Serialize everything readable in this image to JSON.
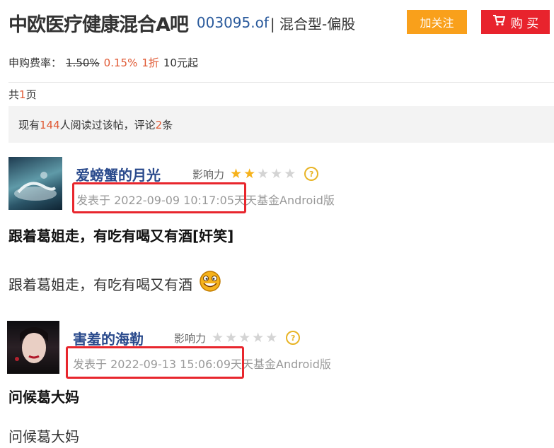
{
  "header": {
    "bar_name": "中欧医疗健康混合A吧",
    "fund_code": "003095.of",
    "fund_type": "| 混合型-偏股",
    "follow_label": "加关注",
    "buy_label": "购 买"
  },
  "fee": {
    "label": "申购费率：",
    "original": "1.50%",
    "current": "0.15%",
    "discount": "1折",
    "minimum": "10元起"
  },
  "pagination": {
    "prefix": "共",
    "count": "1",
    "suffix": "页"
  },
  "read_info": {
    "prefix": "现有",
    "readers": "144",
    "middle": "人阅读过该帖，评论",
    "comments": "2",
    "suffix": "条"
  },
  "posts": [
    {
      "username": "爱螃蟹的月光",
      "influence_label": "影响力",
      "influence_stars": 2,
      "influence_max": 5,
      "posted_at": "发表于 2022-09-09 10:17:05",
      "source": "天天基金Android版",
      "title": "跟着葛姐走，有吃有喝又有酒[奸笑]",
      "body": "跟着葛姐走，有吃有喝又有酒",
      "emoji": "grin-emoji"
    },
    {
      "username": "害羞的海勒",
      "influence_label": "影响力",
      "influence_stars": 0,
      "influence_max": 5,
      "posted_at": "发表于 2022-09-13 15:06:09",
      "source": "天天基金Android版",
      "title": "问候葛大妈",
      "body": "问候葛大妈"
    }
  ],
  "colors": {
    "accent_blue": "#2a4a8c",
    "highlight_red": "#e8262d",
    "follow_orange": "#f9a01b",
    "buy_red": "#e8232d",
    "star_gold": "#f6b21b"
  }
}
